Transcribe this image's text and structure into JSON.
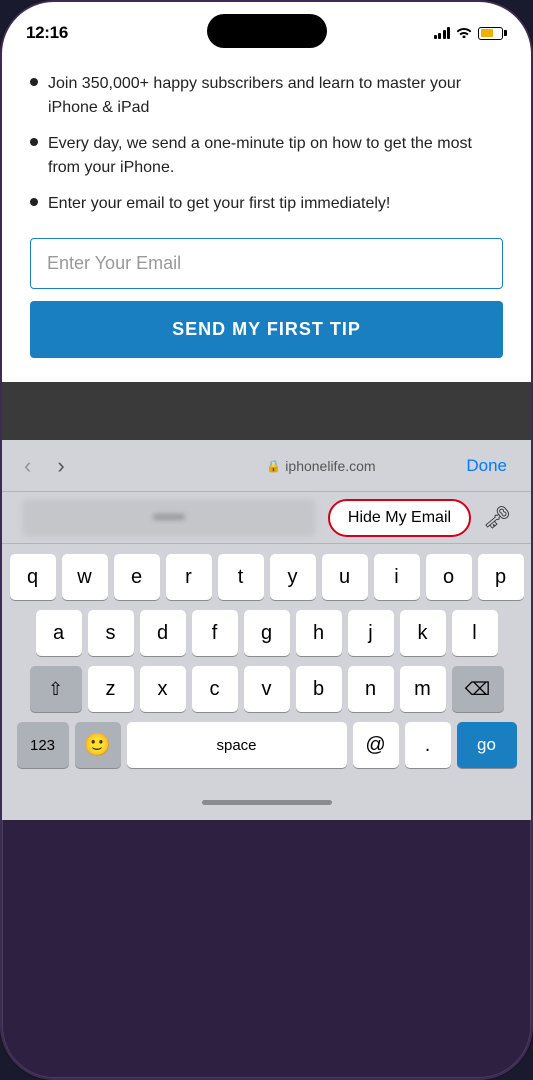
{
  "statusBar": {
    "time": "12:16",
    "domain": "iphonelife.com"
  },
  "webContent": {
    "bullets": [
      "Join 350,000+ happy subscribers and learn to master your iPhone & iPad",
      "Every day, we send a one-minute tip on how to get the most from your iPhone.",
      "Enter your email to get your first tip immediately!"
    ],
    "emailInput": {
      "placeholder": "Enter Your Email"
    },
    "ctaButton": "SEND MY FIRST TIP"
  },
  "toolbar": {
    "doneLabel": "Done",
    "lockSymbol": "🔒"
  },
  "autocomplete": {
    "hideMyEmail": "Hide My Email"
  },
  "keyboard": {
    "rows": [
      [
        "q",
        "w",
        "e",
        "r",
        "t",
        "y",
        "u",
        "i",
        "o",
        "p"
      ],
      [
        "a",
        "s",
        "d",
        "f",
        "g",
        "h",
        "j",
        "k",
        "l"
      ],
      [
        "z",
        "x",
        "c",
        "v",
        "b",
        "n",
        "m"
      ]
    ],
    "spaceLabel": "space",
    "atLabel": "@",
    "periodLabel": ".",
    "goLabel": "go",
    "numberLabel": "123"
  }
}
